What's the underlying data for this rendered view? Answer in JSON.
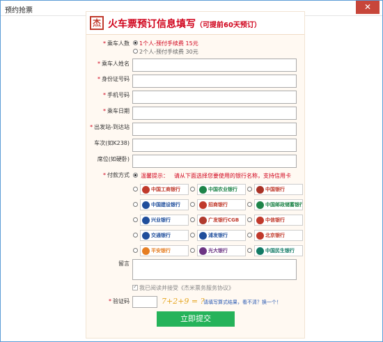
{
  "window": {
    "title": "预约抢票",
    "close_label": "✕"
  },
  "header": {
    "logo": "杰",
    "title": "火车票预订信息填写",
    "subtitle": "（可提前60天预订）"
  },
  "form": {
    "passenger_count": {
      "label": "乘车人数",
      "options": [
        {
          "label": "1个人-预付手续费 15元",
          "selected": true
        },
        {
          "label": "2个人-预付手续费 30元",
          "selected": false
        }
      ]
    },
    "name": {
      "label": "乘车人姓名",
      "value": ""
    },
    "id_number": {
      "label": "身份证号码",
      "value": ""
    },
    "phone": {
      "label": "手机号码",
      "value": ""
    },
    "date": {
      "label": "乘车日期",
      "value": ""
    },
    "route": {
      "label": "出发站-到达站",
      "value": ""
    },
    "train_no": {
      "label": "车次(如K238)",
      "value": ""
    },
    "seat": {
      "label": "席位(如硬卧)",
      "value": ""
    },
    "payment": {
      "label": "付款方式",
      "hint_label": "温馨提示：",
      "hint_text": "请从下面选择您要使用的银行名称，支持信用卡"
    },
    "message": {
      "label": "留言",
      "value": ""
    },
    "agreement": {
      "text": "我已阅读并接受《杰米票务服务协议》"
    },
    "captcha": {
      "label": "验证码",
      "expression": "7+2+9 = ?",
      "tip": "请填写算式结果，看不清？换一个！"
    },
    "submit_label": "立即提交"
  },
  "banks": [
    [
      "中国工商银行",
      "中国农业银行",
      "中国银行"
    ],
    [
      "中国建设银行",
      "招商银行",
      "中国邮政储蓄银行"
    ],
    [
      "兴业银行",
      "广发银行CGB",
      "中信银行"
    ],
    [
      "交通银行",
      "浦发银行",
      "北京银行"
    ],
    [
      "平安银行",
      "光大银行",
      "中国民生银行"
    ]
  ],
  "required_mark": "*"
}
